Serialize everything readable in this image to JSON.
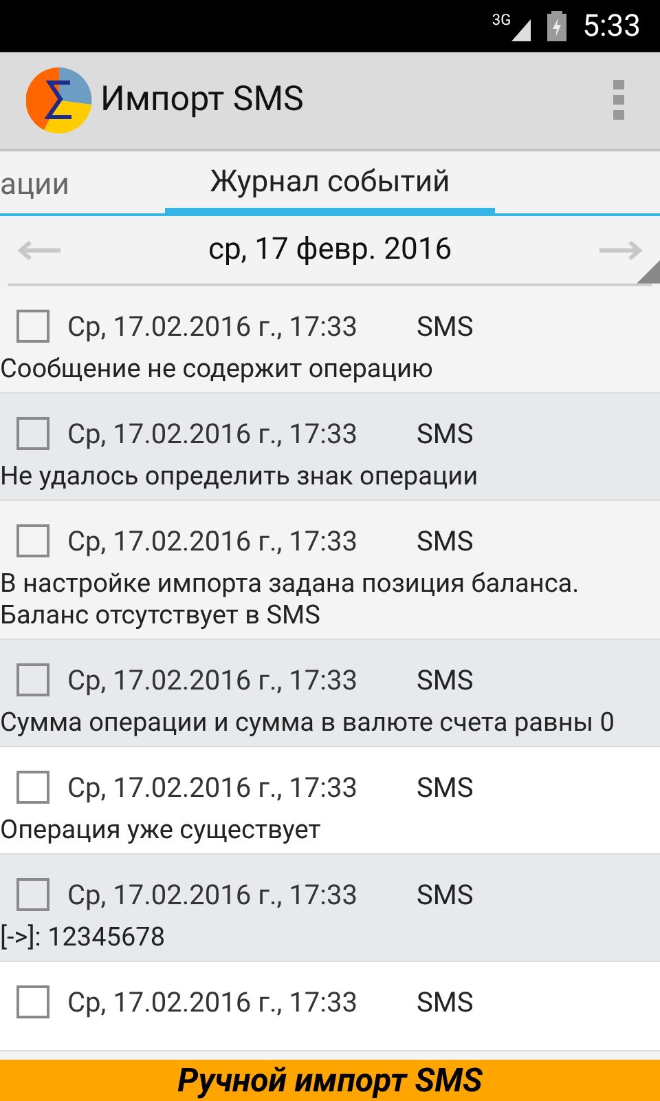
{
  "status_bar": {
    "network": "3G",
    "time": "5:33"
  },
  "app_bar": {
    "title": "Импорт SMS"
  },
  "tabs": [
    {
      "label": "ации",
      "selected": false
    },
    {
      "label": "Журнал событий",
      "selected": true
    }
  ],
  "date_nav": {
    "date": "ср, 17 февр. 2016"
  },
  "events": [
    {
      "checked": false,
      "datetime": "Ср, 17.02.2016 г., 17:33",
      "source": "SMS",
      "message": "Сообщение не содержит операцию"
    },
    {
      "checked": false,
      "datetime": "Ср, 17.02.2016 г., 17:33",
      "source": "SMS",
      "message": "Не удалось определить знак операции"
    },
    {
      "checked": false,
      "datetime": "Ср, 17.02.2016 г., 17:33",
      "source": "SMS",
      "message": "В настройке импорта задана позиция баланса. Баланс отсутствует в SMS"
    },
    {
      "checked": false,
      "datetime": "Ср, 17.02.2016 г., 17:33",
      "source": "SMS",
      "message": "Сумма операции и сумма в валюте счета равны 0"
    },
    {
      "checked": false,
      "datetime": "Ср, 17.02.2016 г., 17:33",
      "source": "SMS",
      "message": "Операция уже существует"
    },
    {
      "checked": false,
      "datetime": "Ср, 17.02.2016 г., 17:33",
      "source": "SMS",
      "message": "[->]: 12345678"
    },
    {
      "checked": false,
      "datetime": "Ср, 17.02.2016 г., 17:33",
      "source": "SMS"
    }
  ],
  "bottom_button": {
    "label": "Ручной импорт SMS"
  }
}
